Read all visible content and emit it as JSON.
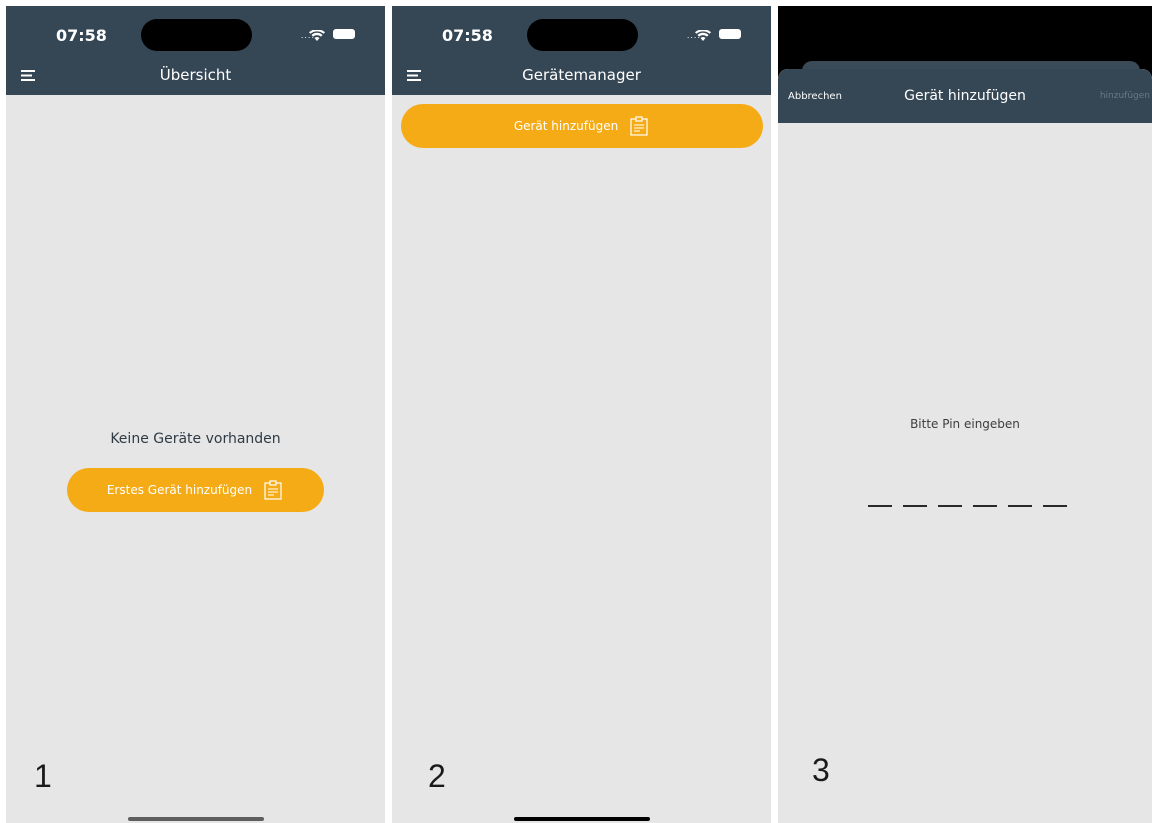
{
  "screen1": {
    "status_time": "07:58",
    "nav_title": "Übersicht",
    "empty_message": "Keine Geräte vorhanden",
    "add_first_button_label": "Erstes Gerät hinzufügen",
    "step_number": "1"
  },
  "screen2": {
    "status_time": "07:58",
    "nav_title": "Gerätemanager",
    "add_device_button_label": "Gerät hinzufügen",
    "step_number": "2"
  },
  "screen3": {
    "cancel_label": "Abbrechen",
    "modal_title": "Gerät hinzufügen",
    "add_label": "hinzufügen",
    "pin_prompt": "Bitte Pin eingeben",
    "pin_digits": [
      "",
      "",
      "",
      "",
      "",
      ""
    ],
    "step_number": "3"
  },
  "colors": {
    "header": "#354654",
    "accent": "#f5ab16",
    "background": "#e6e6e6"
  },
  "icons": [
    "menu-icon",
    "clipboard-icon",
    "wifi-icon",
    "battery-icon"
  ]
}
